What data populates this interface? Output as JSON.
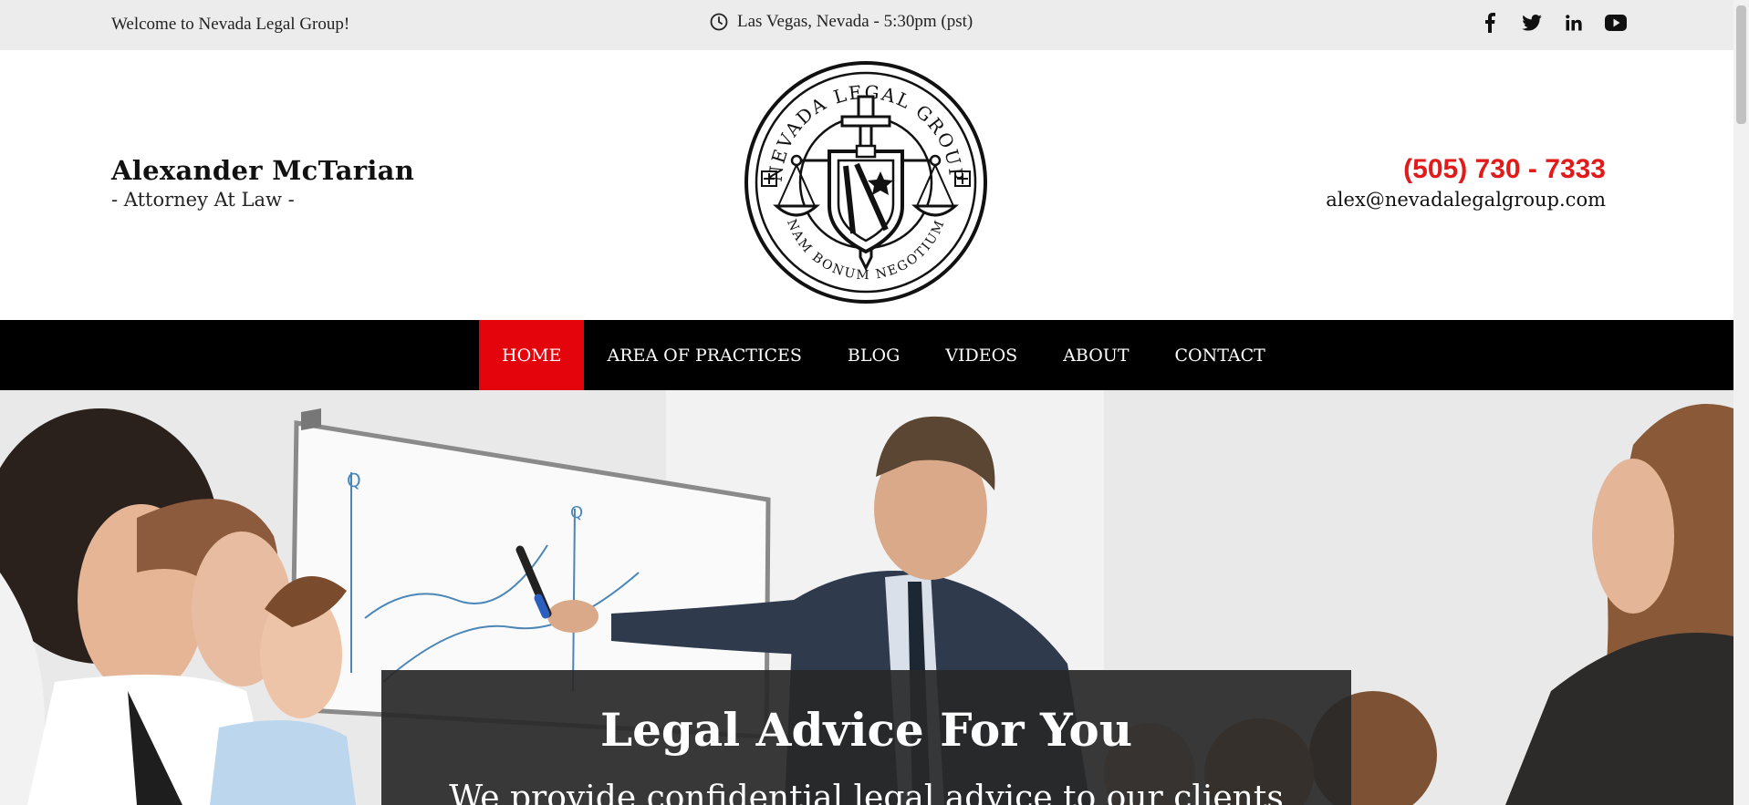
{
  "topbar": {
    "welcome": "Welcome to Nevada Legal Group!",
    "location": "Las Vegas, Nevada - 5:30pm (pst)",
    "clock_icon": "clock-icon",
    "social": [
      "facebook-icon",
      "twitter-icon",
      "linkedin-icon",
      "youtube-icon"
    ]
  },
  "header": {
    "name": "Alexander McTarian",
    "title": "- Attorney At Law -",
    "phone": "(505) 730 - 7333",
    "email": "alex@nevadalegalgroup.com",
    "logo": {
      "top_text": "NEVADA LEGAL GROUP",
      "bottom_text": "NAM BONUM NEGOTIUM"
    }
  },
  "nav": {
    "items": [
      {
        "label": "HOME",
        "active": true
      },
      {
        "label": "AREA OF PRACTICES",
        "active": false
      },
      {
        "label": "BLOG",
        "active": false
      },
      {
        "label": "VIDEOS",
        "active": false
      },
      {
        "label": "ABOUT",
        "active": false
      },
      {
        "label": "CONTACT",
        "active": false
      }
    ]
  },
  "hero": {
    "heading": "Legal Advice For You",
    "subheading": "We provide confidential legal advice to our clients"
  },
  "colors": {
    "accent": "#e4040b",
    "phone": "#e11b1b",
    "topbar_bg": "#ececec",
    "nav_bg": "#000000"
  }
}
